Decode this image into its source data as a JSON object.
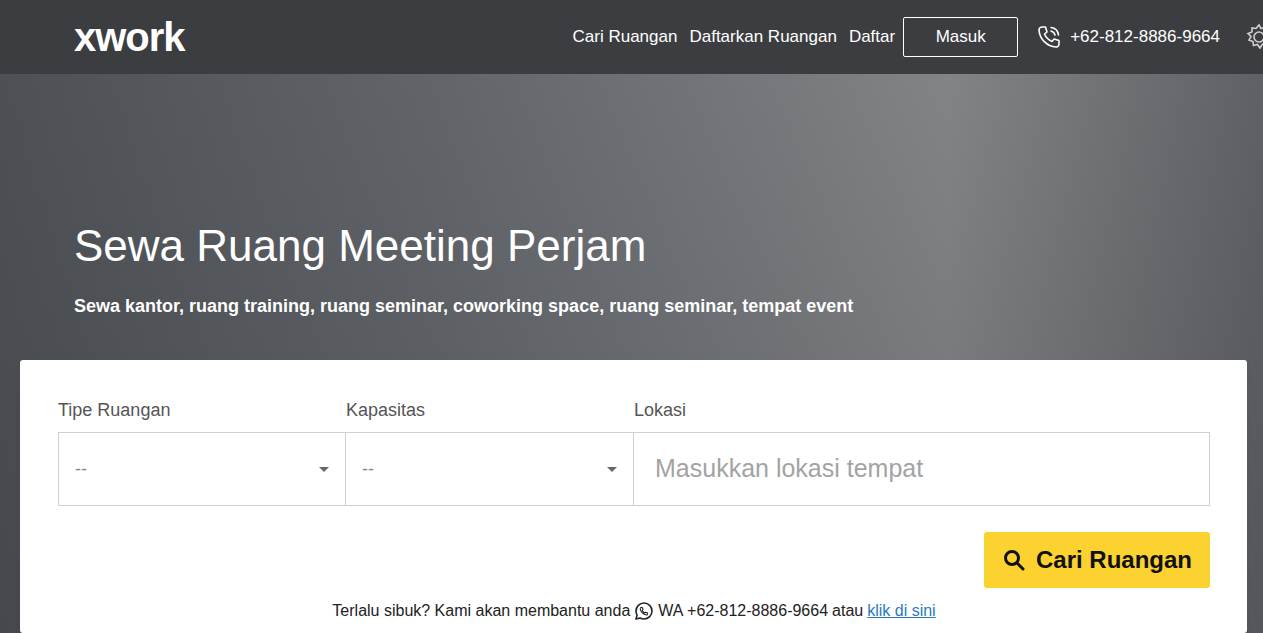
{
  "logo": "xwork",
  "nav": {
    "links": [
      {
        "label": "Cari Ruangan"
      },
      {
        "label": "Daftarkan Ruangan"
      },
      {
        "label": "Daftar"
      }
    ],
    "login_button": "Masuk",
    "phone": "+62-812-8886-9664"
  },
  "hero": {
    "title": "Sewa Ruang Meeting Perjam",
    "subtitle": "Sewa kantor, ruang training, ruang seminar, coworking space, ruang seminar, tempat event"
  },
  "search": {
    "fields": [
      {
        "label": "Tipe Ruangan",
        "kind": "select",
        "value": "--"
      },
      {
        "label": "Kapasitas",
        "kind": "select",
        "value": "--"
      },
      {
        "label": "Lokasi",
        "kind": "text",
        "placeholder": "Masukkan lokasi tempat"
      }
    ],
    "button": "Cari Ruangan"
  },
  "help": {
    "text": "Terlalu sibuk? Kami akan membantu anda",
    "whatsapp": "WA +62-812-8886-9664",
    "separator": "atau",
    "link": "klik di sini"
  }
}
